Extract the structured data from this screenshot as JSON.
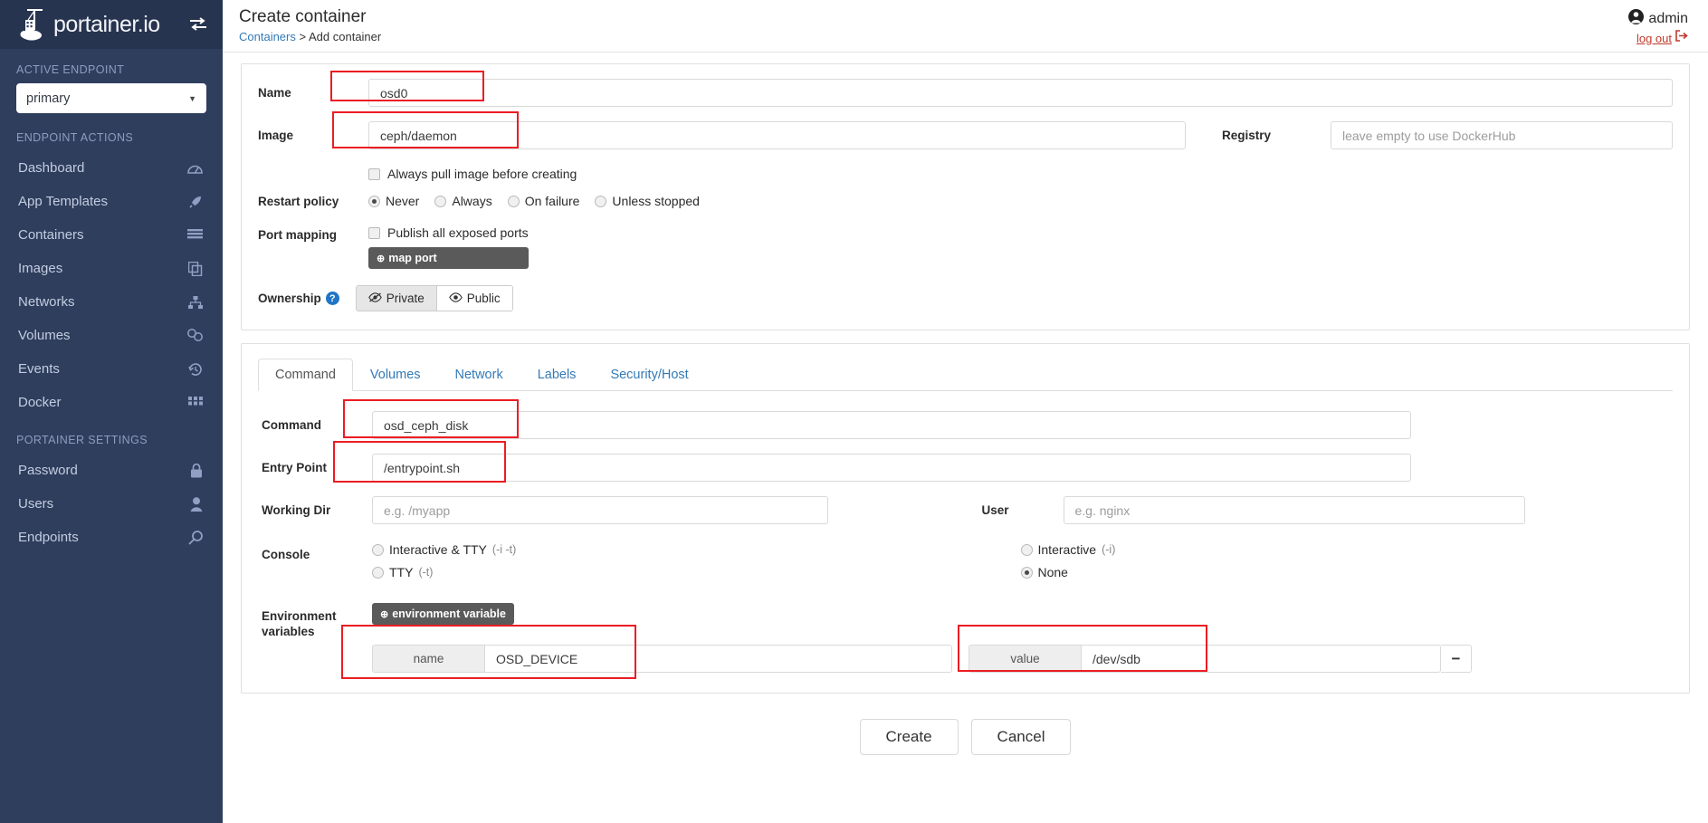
{
  "sidebar": {
    "brand": "portainer.io",
    "toggle_icon": "collapse-sidebar-icon",
    "active_endpoint_label": "ACTIVE ENDPOINT",
    "endpoint_value": "primary",
    "endpoint_actions_label": "ENDPOINT ACTIONS",
    "portainer_settings_label": "PORTAINER SETTINGS",
    "endpoint_actions": [
      {
        "label": "Dashboard",
        "icon": "dashboard-icon"
      },
      {
        "label": "App Templates",
        "icon": "rocket-icon"
      },
      {
        "label": "Containers",
        "icon": "containers-icon"
      },
      {
        "label": "Images",
        "icon": "images-icon"
      },
      {
        "label": "Networks",
        "icon": "networks-icon"
      },
      {
        "label": "Volumes",
        "icon": "volumes-icon"
      },
      {
        "label": "Events",
        "icon": "history-icon"
      },
      {
        "label": "Docker",
        "icon": "docker-grid-icon"
      }
    ],
    "portainer_settings": [
      {
        "label": "Password",
        "icon": "lock-icon"
      },
      {
        "label": "Users",
        "icon": "user-icon"
      },
      {
        "label": "Endpoints",
        "icon": "plug-icon"
      }
    ]
  },
  "header": {
    "title": "Create container",
    "breadcrumb_root": "Containers",
    "breadcrumb_sep": ">",
    "breadcrumb_current": "Add container",
    "user_name": "admin",
    "user_icon": "user-circle-icon",
    "logout_label": "log out",
    "logout_icon": "sign-out-icon"
  },
  "form": {
    "name_label": "Name",
    "name_value": "osd0",
    "image_label": "Image",
    "image_value": "ceph/daemon",
    "registry_label": "Registry",
    "registry_placeholder": "leave empty to use DockerHub",
    "registry_value": "",
    "always_pull_label": "Always pull image before creating",
    "restart_policy_label": "Restart policy",
    "restart_policy_options": [
      {
        "label": "Never",
        "selected": true
      },
      {
        "label": "Always",
        "selected": false
      },
      {
        "label": "On failure",
        "selected": false
      },
      {
        "label": "Unless stopped",
        "selected": false
      }
    ],
    "port_mapping_label": "Port mapping",
    "publish_all_label": "Publish all exposed ports",
    "map_port_button": "map port",
    "ownership_label": "Ownership",
    "ownership_help": "?",
    "ownership_private": "Private",
    "ownership_public": "Public",
    "ownership_selected": "Private"
  },
  "tabs": [
    {
      "label": "Command",
      "active": true
    },
    {
      "label": "Volumes",
      "active": false
    },
    {
      "label": "Network",
      "active": false
    },
    {
      "label": "Labels",
      "active": false
    },
    {
      "label": "Security/Host",
      "active": false
    }
  ],
  "command_tab": {
    "command_label": "Command",
    "command_value": "osd_ceph_disk",
    "entrypoint_label": "Entry Point",
    "entrypoint_value": "/entrypoint.sh",
    "working_dir_label": "Working Dir",
    "working_dir_placeholder": "e.g. /myapp",
    "working_dir_value": "",
    "user_label": "User",
    "user_placeholder": "e.g. nginx",
    "user_value": "",
    "console_label": "Console",
    "console_options": [
      {
        "label": "Interactive & TTY",
        "hint": "(-i -t)",
        "selected": false
      },
      {
        "label": "TTY",
        "hint": "(-t)",
        "selected": false
      },
      {
        "label": "Interactive",
        "hint": "(-i)",
        "selected": false
      },
      {
        "label": "None",
        "hint": "",
        "selected": true
      }
    ],
    "env_label_line1": "Environment",
    "env_label_line2": "variables",
    "env_button": "environment variable",
    "env_name_addon": "name",
    "env_value_addon": "value",
    "env_rows": [
      {
        "name": "OSD_DEVICE",
        "value": "/dev/sdb",
        "remove_icon": "minus-icon"
      }
    ]
  },
  "footer": {
    "create_label": "Create",
    "cancel_label": "Cancel"
  },
  "colors": {
    "sidebar_bg": "#2f3e5d",
    "sidebar_header_bg": "#27344f",
    "link_blue": "#337ab7",
    "logout_red": "#c0392b",
    "annotation_red": "#ec1c24"
  }
}
